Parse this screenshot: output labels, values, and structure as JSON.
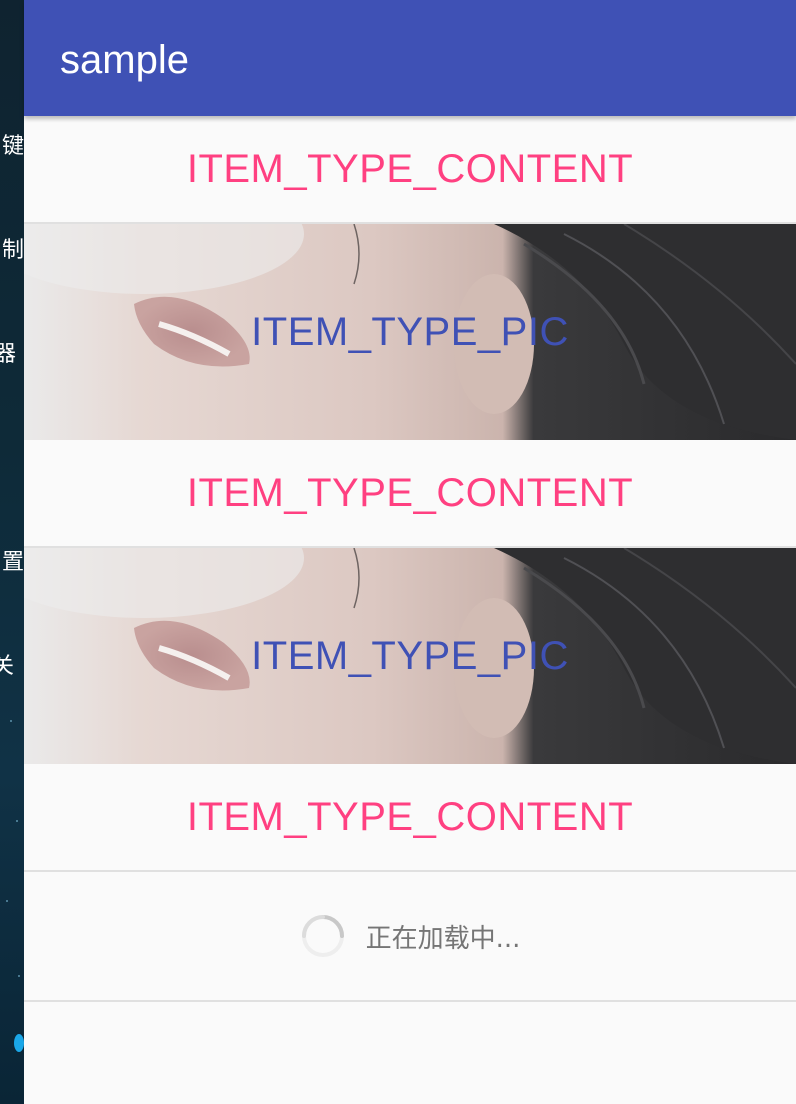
{
  "left_strip": {
    "fragments": [
      "键",
      "制",
      "器",
      "置",
      "关"
    ]
  },
  "toolbar": {
    "title": "sample",
    "color": "#3f51b5"
  },
  "list": {
    "content_label": "ITEM_TYPE_CONTENT",
    "pic_label": "ITEM_TYPE_PIC",
    "content_color": "#ff4081",
    "pic_color": "#3f51b5",
    "items": [
      {
        "type": "content",
        "label": "ITEM_TYPE_CONTENT"
      },
      {
        "type": "pic",
        "label": "ITEM_TYPE_PIC"
      },
      {
        "type": "content",
        "label": "ITEM_TYPE_CONTENT"
      },
      {
        "type": "pic",
        "label": "ITEM_TYPE_PIC"
      },
      {
        "type": "content",
        "label": "ITEM_TYPE_CONTENT"
      }
    ]
  },
  "footer": {
    "loading_text": "正在加载中...",
    "icon": "loading-spinner-icon"
  }
}
